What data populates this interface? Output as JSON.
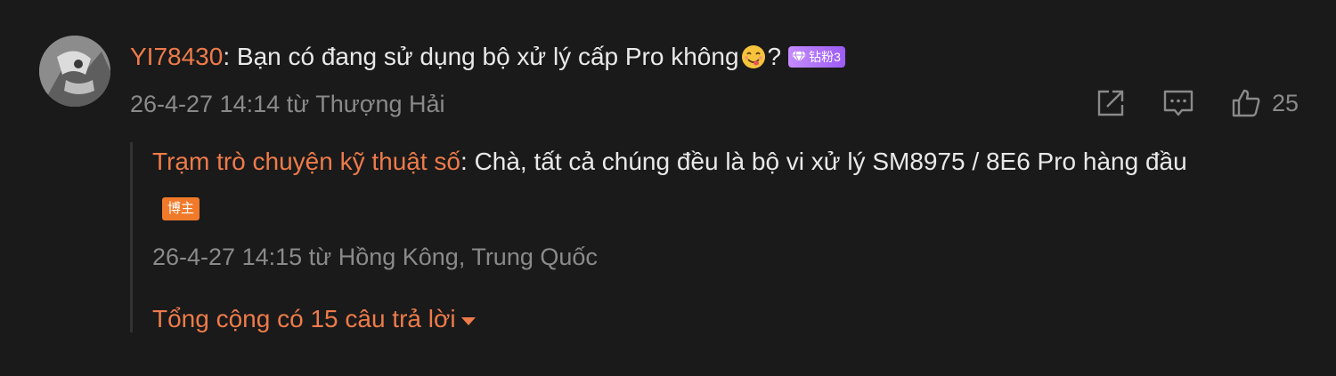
{
  "comment": {
    "username": "YI78430",
    "separator": ": ",
    "text": "Bạn có đang sử dụng bộ xử lý cấp Pro không",
    "after_emoji": "?",
    "emoji_icon": "yum-face-emoji",
    "badge_label": "钻粉3",
    "timestamp": "26-4-27 14:14 từ Thượng Hải",
    "likes": "25"
  },
  "reply": {
    "username": "Trạm trò chuyện kỹ thuật số",
    "separator": ": ",
    "text": "Chà, tất cả chúng đều là bộ vi xử lý SM8975 / 8E6 Pro hàng đầu",
    "badge_label": "博主",
    "timestamp": "26-4-27 14:15 từ Hồng Kông, Trung Quốc"
  },
  "total_replies": "Tổng cộng có 15 câu trả lời",
  "icons": [
    "share-icon",
    "reply-icon",
    "thumbs-up-icon",
    "caret-down-icon",
    "diamond-icon"
  ],
  "colors": {
    "background": "#1a1a1a",
    "username": "#ee7b4a",
    "text": "#e9e9e9",
    "meta": "#8a8a8a",
    "diamond_badge": "#a86cf7",
    "blogger_badge": "#f07a2a"
  }
}
